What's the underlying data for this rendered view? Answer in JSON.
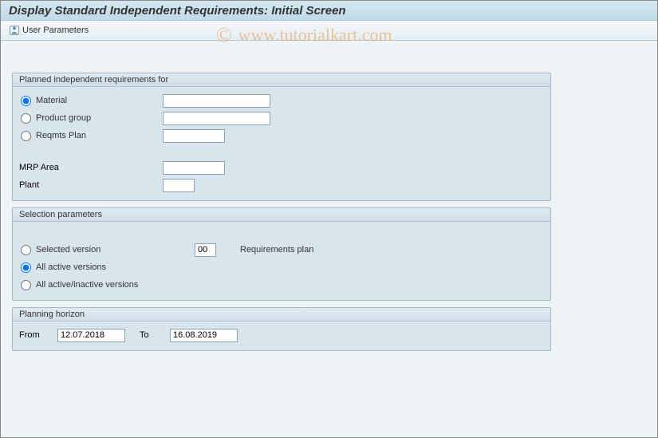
{
  "title": "Display Standard Independent Requirements: Initial Screen",
  "toolbar": {
    "userParams": "User Parameters"
  },
  "watermark": {
    "copyright": "©",
    "text": "www.tutorialkart.com"
  },
  "group1": {
    "title": "Planned independent requirements for",
    "opt_material": "Material",
    "opt_prodgroup": "Product group",
    "opt_reqplan": "Reqmts Plan",
    "lbl_mrparea": "MRP Area",
    "lbl_plant": "Plant",
    "val_material": "",
    "val_prodgroup": "",
    "val_reqplan": "",
    "val_mrparea": "",
    "val_plant": ""
  },
  "group2": {
    "title": "Selection parameters",
    "opt_selver": "Selected version",
    "opt_allactive": "All active versions",
    "opt_allinactive": "All active/inactive versions",
    "val_selver": "00",
    "lbl_reqplan": "Requirements plan"
  },
  "group3": {
    "title": "Planning horizon",
    "lbl_from": "From",
    "lbl_to": "To",
    "val_from": "12.07.2018",
    "val_to": "16.08.2019"
  }
}
